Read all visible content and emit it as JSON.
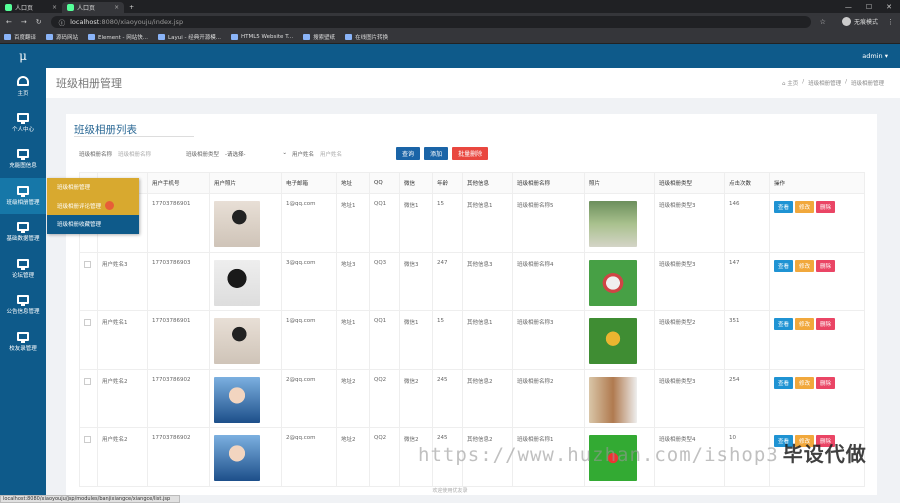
{
  "browser": {
    "tabs": [
      {
        "title": "人口页"
      },
      {
        "title": "人口页"
      }
    ],
    "url_host": "localhost",
    "url_path": ":8080/xiaoyouju/index.jsp",
    "profile": "无痕模式",
    "bookmarks": [
      "百度翻译",
      "源码网站",
      "Element - 网站快...",
      "Layui - 经典开源模...",
      "HTML5 Website T...",
      "搜索壁纸",
      "在线图片转换"
    ]
  },
  "header": {
    "logo": "μ",
    "user": "admin ▾"
  },
  "sidebar": {
    "items": [
      {
        "label": "主页",
        "icon": "dashboard-icon"
      },
      {
        "label": "个人中心",
        "icon": "monitor-icon"
      },
      {
        "label": "充能图信息",
        "icon": "monitor-icon"
      },
      {
        "label": "班级相册管理",
        "icon": "monitor-icon"
      },
      {
        "label": "基础数据管理",
        "icon": "monitor-icon"
      },
      {
        "label": "论坛管理",
        "icon": "monitor-icon"
      },
      {
        "label": "公告信息管理",
        "icon": "monitor-icon"
      },
      {
        "label": "校友录管理",
        "icon": "monitor-icon"
      }
    ]
  },
  "submenu": {
    "items": [
      "班级相册管理",
      "班级相册评论管理",
      "班级相册收藏管理"
    ]
  },
  "page": {
    "title": "班级相册管理",
    "breadcrumb": [
      "⌂ 主页",
      "班级相册管理",
      "班级相册管理"
    ]
  },
  "list": {
    "title": "班级相册列表",
    "search": {
      "name_label": "班级相册名称",
      "name_placeholder": "班级相册名称",
      "type_label": "班级相册类型",
      "type_value": "-请选择-",
      "user_label": "用户姓名",
      "user_placeholder": "用户姓名",
      "query": "查询",
      "add": "添加",
      "batch_delete": "批量删除"
    },
    "columns": [
      "",
      "用户姓名",
      "用户手机号",
      "用户照片",
      "电子邮箱",
      "地址",
      "QQ",
      "微信",
      "年龄",
      "其他信息",
      "班级相册名称",
      "照片",
      "班级相册类型",
      "点击次数",
      "操作"
    ],
    "actions": {
      "view": "查看",
      "edit": "修改",
      "delete": "删除"
    },
    "rows": [
      {
        "name": "",
        "phone": "17703786901",
        "email": "1@qq.com",
        "addr": "地址1",
        "qq": "QQ1",
        "wx": "微信1",
        "age": "15",
        "other": "其他信息1",
        "album": "班级相册名称5",
        "type": "班级相册类型3",
        "clicks": "146"
      },
      {
        "name": "用户姓名3",
        "phone": "17703786903",
        "email": "3@qq.com",
        "addr": "地址3",
        "qq": "QQ3",
        "wx": "微信3",
        "age": "247",
        "other": "其他信息3",
        "album": "班级相册名称4",
        "type": "班级相册类型3",
        "clicks": "147"
      },
      {
        "name": "用户姓名1",
        "phone": "17703786901",
        "email": "1@qq.com",
        "addr": "地址1",
        "qq": "QQ1",
        "wx": "微信1",
        "age": "15",
        "other": "其他信息1",
        "album": "班级相册名称3",
        "type": "班级相册类型2",
        "clicks": "351"
      },
      {
        "name": "用户姓名2",
        "phone": "17703786902",
        "email": "2@qq.com",
        "addr": "地址2",
        "qq": "QQ2",
        "wx": "微信2",
        "age": "245",
        "other": "其他信息2",
        "album": "班级相册名称2",
        "type": "班级相册类型3",
        "clicks": "254"
      },
      {
        "name": "用户姓名2",
        "phone": "17703786902",
        "email": "2@qq.com",
        "addr": "地址2",
        "qq": "QQ2",
        "wx": "微信2",
        "age": "245",
        "other": "其他信息2",
        "album": "班级相册名称1",
        "type": "班级相册类型4",
        "clicks": "10"
      }
    ]
  },
  "footer": "欢迎使用优友录",
  "status_url": "localhost:8080/xiaoyouju/jsp/modules/banjixiangce/xiangce/list.jsp",
  "watermark": {
    "url": "https://www.huzhan.com/ishop3",
    "brand": "毕设代做"
  }
}
